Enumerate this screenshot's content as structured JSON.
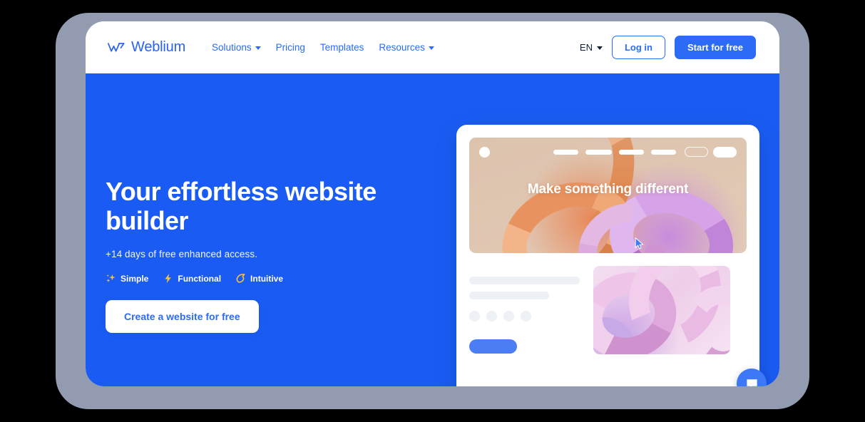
{
  "brand": {
    "name": "Weblium",
    "logo_icon": "weblium-logo-icon"
  },
  "nav": {
    "items": [
      {
        "label": "Solutions",
        "has_caret": true
      },
      {
        "label": "Pricing",
        "has_caret": false
      },
      {
        "label": "Templates",
        "has_caret": false
      },
      {
        "label": "Resources",
        "has_caret": true
      }
    ]
  },
  "header_actions": {
    "language": "EN",
    "language_caret_icon": "chevron-down-icon",
    "login_label": "Log in",
    "start_label": "Start for free"
  },
  "hero": {
    "title": "Your effortless website builder",
    "subtitle": "+14 days of free enhanced access.",
    "badges": [
      {
        "label": "Simple",
        "icon": "sparkles-icon"
      },
      {
        "label": "Functional",
        "icon": "lightning-bolt-icon"
      },
      {
        "label": "Intuitive",
        "icon": "comet-icon"
      }
    ],
    "cta_label": "Create a website for free"
  },
  "mockup": {
    "banner_title": "Make something different",
    "nav_logo_icon": "circle-logo-icon",
    "cursor_icon": "cursor-arrow-icon",
    "photo_alt": "abstract-3d-pink-tubes"
  },
  "chat": {
    "icon": "chat-bubble-icon"
  },
  "colors": {
    "brand_blue": "#2B6BF5",
    "hero_blue": "#1A5CF3",
    "bezel_gray": "#929BB0",
    "badge_gold": "#F5C33B",
    "skeleton_gray": "#EDF0F4",
    "page_background": "#000000"
  }
}
